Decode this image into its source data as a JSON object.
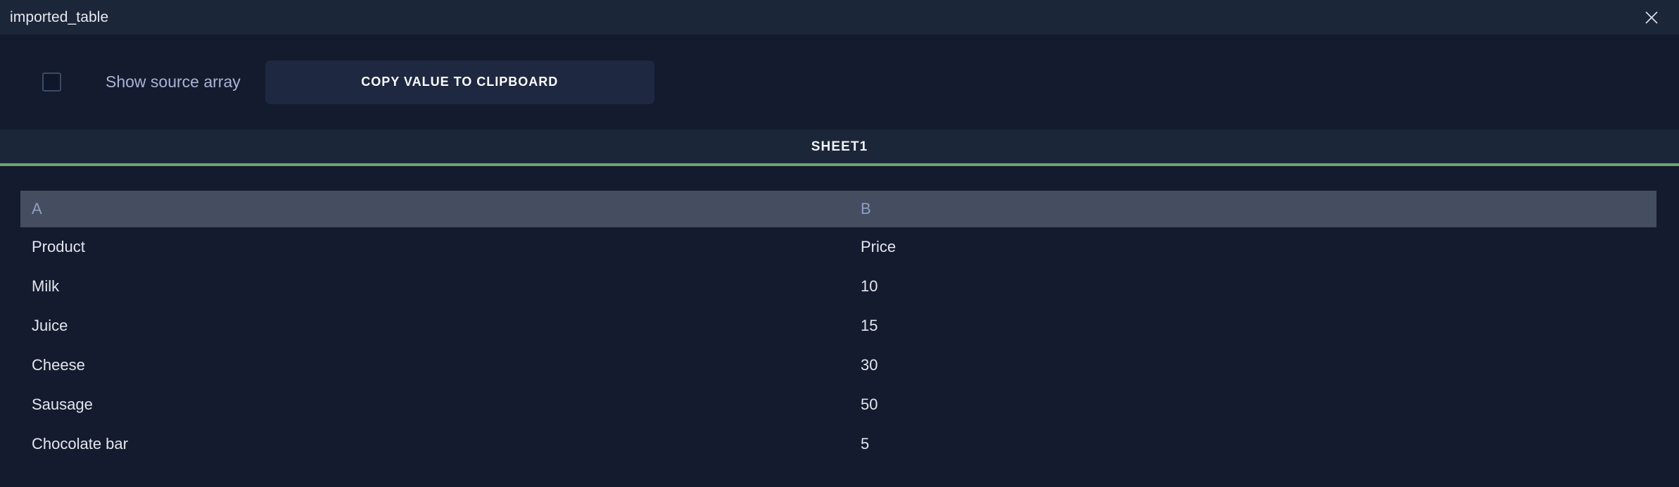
{
  "window": {
    "title": "imported_table",
    "close_icon": "close-icon"
  },
  "toolbar": {
    "checkbox_checked": false,
    "checkbox_label": "Show source array",
    "copy_button_label": "COPY VALUE TO CLIPBOARD"
  },
  "sheet_tabs": {
    "active_index": 0,
    "items": [
      {
        "label": "SHEET1"
      }
    ],
    "underline_color": "#6ba86e"
  },
  "table": {
    "columns": [
      {
        "label": "A"
      },
      {
        "label": "B"
      }
    ],
    "rows": [
      {
        "a": "Product",
        "b": "Price"
      },
      {
        "a": "Milk",
        "b": "10"
      },
      {
        "a": "Juice",
        "b": "15"
      },
      {
        "a": "Cheese",
        "b": "30"
      },
      {
        "a": "Sausage",
        "b": "50"
      },
      {
        "a": "Chocolate bar",
        "b": "5"
      }
    ]
  },
  "colors": {
    "titlebar_bg": "#1c2639",
    "body_bg": "#141b2e",
    "button_bg": "#1e2840",
    "table_header_bg": "#444e60",
    "accent_green": "#6ba86e",
    "label_text": "#a8b4d4",
    "cell_text": "#e3e6ed"
  }
}
